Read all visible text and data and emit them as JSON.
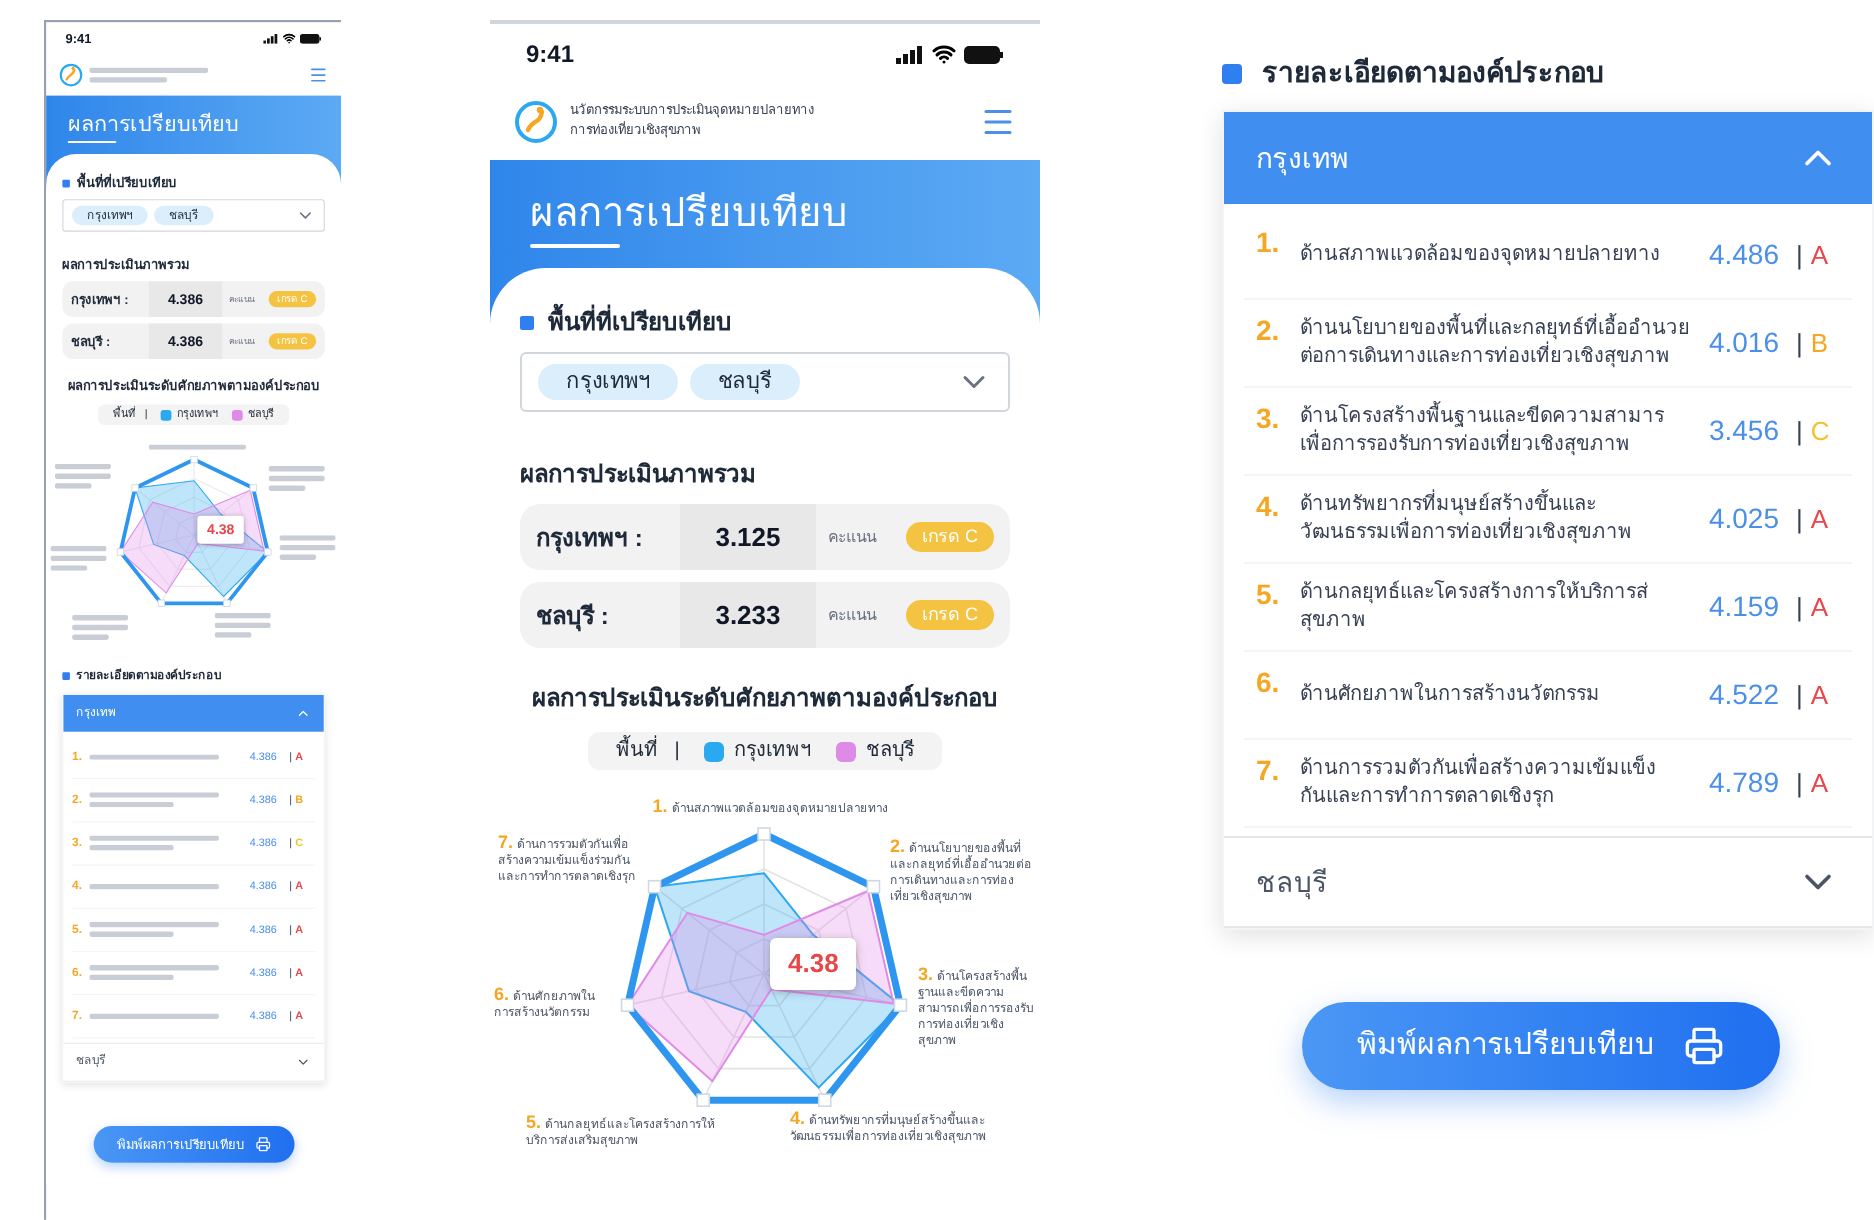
{
  "phones": [
    {
      "status_bar": {
        "time": "9:41"
      },
      "page_title": "ผลการเปรียบเทียบ",
      "area_select": {
        "label": "พื้นที่ที่เปรียบเทียบ",
        "chips": [
          "กรุงเทพฯ",
          "ชลบุรี"
        ]
      },
      "overall": {
        "title": "ผลการประเมินภาพรวม",
        "rows": [
          {
            "name": "กรุงเทพฯ :",
            "score": "4.386",
            "unit": "คะแนน",
            "grade": "เกรด C"
          },
          {
            "name": "ชลบุรี :",
            "score": "4.386",
            "unit": "คะแนน",
            "grade": "เกรด C"
          }
        ]
      },
      "chart": {
        "title": "ผลการประเมินระดับศักยภาพตามองค์ประกอบ",
        "legend": {
          "label": "พื้นที่",
          "separator": "|",
          "series": [
            {
              "name": "กรุงเทพฯ",
              "color": "#2aa8f0"
            },
            {
              "name": "ชลบุรี",
              "color": "#e08ae8"
            }
          ]
        },
        "tooltip": "4.38"
      },
      "details": {
        "title": "รายละเอียดตามองค์ประกอบ",
        "sections": [
          {
            "name": "กรุงเทพ",
            "expanded": true,
            "rows": [
              {
                "num": "1.",
                "score": "4.386",
                "separator": "|",
                "grade": "A",
                "color": "#e8474a"
              },
              {
                "num": "2.",
                "score": "4.386",
                "separator": "|",
                "grade": "B",
                "color": "#f5a623"
              },
              {
                "num": "3.",
                "score": "4.386",
                "separator": "|",
                "grade": "C",
                "color": "#f2c230"
              },
              {
                "num": "4.",
                "score": "4.386",
                "separator": "|",
                "grade": "A",
                "color": "#e8474a"
              },
              {
                "num": "5.",
                "score": "4.386",
                "separator": "|",
                "grade": "A",
                "color": "#e8474a"
              },
              {
                "num": "6.",
                "score": "4.386",
                "separator": "|",
                "grade": "A",
                "color": "#e8474a"
              },
              {
                "num": "7.",
                "score": "4.386",
                "separator": "|",
                "grade": "A",
                "color": "#e8474a"
              }
            ]
          },
          {
            "name": "ชลบุรี",
            "expanded": false
          }
        ]
      },
      "print_button": "พิมพ์ผลการเปรียบเทียบ"
    },
    {
      "status_bar": {
        "time": "9:41"
      },
      "header": {
        "title_lines": [
          "นวัตกรรมระบบการประเมินจุดหมายปลายทาง",
          "การท่องเที่ยวเชิงสุขภาพ"
        ]
      },
      "page_title": "ผลการเปรียบเทียบ",
      "area_select": {
        "label": "พื้นที่ที่เปรียบเทียบ",
        "chips": [
          "กรุงเทพฯ",
          "ชลบุรี"
        ]
      },
      "overall": {
        "title": "ผลการประเมินภาพรวม",
        "rows": [
          {
            "name": "กรุงเทพฯ :",
            "score": "3.125",
            "unit": "คะแนน",
            "grade": "เกรด C"
          },
          {
            "name": "ชลบุรี :",
            "score": "3.233",
            "unit": "คะแนน",
            "grade": "เกรด C"
          }
        ]
      },
      "chart": {
        "title": "ผลการประเมินระดับศักยภาพตามองค์ประกอบ",
        "legend": {
          "label": "พื้นที่",
          "separator": "|",
          "series": [
            {
              "name": "กรุงเทพฯ",
              "color": "#2aa8f0"
            },
            {
              "name": "ชลบุรี",
              "color": "#e08ae8"
            }
          ]
        },
        "axes": [
          {
            "num": "1.",
            "label": "ด้านสภาพแวดล้อมของจุดหมายปลายทาง"
          },
          {
            "num": "7.",
            "label": "ด้านการรวมตัวกันเพื่อสร้างความเข้มแข็งร่วมกันและการทำการตลาดเชิงรุก"
          },
          {
            "num": "2.",
            "label": "ด้านนโยบายของพื้นที่และกลยุทธ์ที่เอื้ออำนวยต่อการเดินทางและการท่องเที่ยวเชิงสุขภาพ"
          },
          {
            "num": "6.",
            "label": "ด้านศักยภาพในการสร้างนวัตกรรม"
          },
          {
            "num": "3.",
            "label": "ด้านโครงสร้างพื้นฐานและขีดความสามารถเพื่อการรองรับการท่องเที่ยวเชิงสุขภาพ"
          },
          {
            "num": "5.",
            "label": "ด้านกลยุทธ์และโครงสร้างการให้บริการส่งเสริมสุขภาพ"
          },
          {
            "num": "4.",
            "label": "ด้านทรัพยากรที่มนุษย์สร้างขึ้นและวัฒนธรรมเพื่อการท่องเที่ยวเชิงสุขภาพ"
          }
        ],
        "tooltip": "4.38"
      }
    }
  ],
  "detail_panel": {
    "title": "รายละเอียดตามองค์ประกอบ",
    "sections": [
      {
        "name": "กรุงเทพ",
        "expanded": true,
        "rows": [
          {
            "num": "1.",
            "lines": [
              "ด้านสภาพแวดล้อมของจุดหมายปลายทาง"
            ],
            "score": "4.486",
            "separator": "|",
            "grade": "A",
            "color": "#e8474a"
          },
          {
            "num": "2.",
            "lines": [
              "ด้านนโยบายของพื้นที่และกลยุทธ์ที่เอื้ออำนวย",
              "ต่อการเดินทางและการท่องเที่ยวเชิงสุขภาพ"
            ],
            "score": "4.016",
            "separator": "|",
            "grade": "B",
            "color": "#f5a623"
          },
          {
            "num": "3.",
            "lines": [
              "ด้านโครงสร้างพื้นฐานและขีดความสามาร",
              "เพื่อการรองรับการท่องเที่ยวเชิงสุขภาพ"
            ],
            "score": "3.456",
            "separator": "|",
            "grade": "C",
            "color": "#f2c230"
          },
          {
            "num": "4.",
            "lines": [
              "ด้านทรัพยากรที่มนุษย์สร้างขึ้นและ",
              "วัฒนธรรมเพื่อการท่องเที่ยวเชิงสุขภาพ"
            ],
            "score": "4.025",
            "separator": "|",
            "grade": "A",
            "color": "#e8474a"
          },
          {
            "num": "5.",
            "lines": [
              "ด้านกลยุทธ์และโครงสร้างการให้บริการส่",
              "สุขภาพ"
            ],
            "score": "4.159",
            "separator": "|",
            "grade": "A",
            "color": "#e8474a"
          },
          {
            "num": "6.",
            "lines": [
              "ด้านศักยภาพในการสร้างนวัตกรรม"
            ],
            "score": "4.522",
            "separator": "|",
            "grade": "A",
            "color": "#e8474a"
          },
          {
            "num": "7.",
            "lines": [
              "ด้านการรวมตัวกันเพื่อสร้างความเข้มแข็ง",
              "กันและการทำการตลาดเชิงรุก"
            ],
            "score": "4.789",
            "separator": "|",
            "grade": "A",
            "color": "#e8474a"
          }
        ]
      },
      {
        "name": "ชลบุรี",
        "expanded": false
      }
    ]
  },
  "print_button": "พิมพ์ผลการเปรียบเทียบ"
}
